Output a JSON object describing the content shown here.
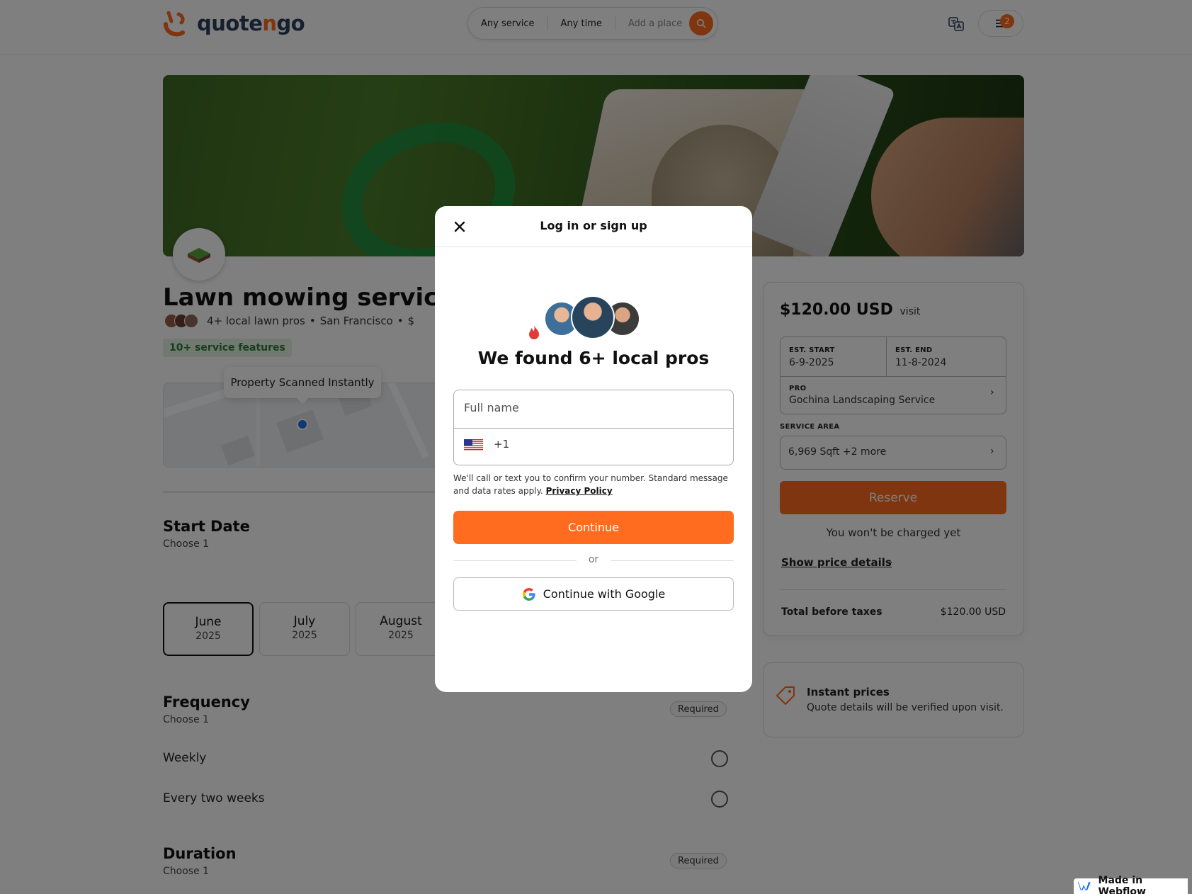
{
  "header": {
    "logo_text_pre": "quote",
    "logo_text_n": "n",
    "logo_text_post": "go",
    "search": {
      "service": "Any service",
      "time": "Any time",
      "place_placeholder": "Add a place"
    },
    "menu_badge": "2"
  },
  "listing": {
    "title": "Lawn mowing service",
    "pros_text": "4+ local lawn pros",
    "location": "San Francisco",
    "price_level": "$",
    "features_chip": "10+ service features",
    "map_tooltip": "Property Scanned Instantly"
  },
  "start_date": {
    "title": "Start Date",
    "sub": "Choose 1",
    "months": [
      {
        "month": "June",
        "year": "2025",
        "selected": true
      },
      {
        "month": "July",
        "year": "2025",
        "selected": false
      },
      {
        "month": "August",
        "year": "2025",
        "selected": false
      }
    ]
  },
  "frequency": {
    "title": "Frequency",
    "sub": "Choose 1",
    "required": "Required",
    "options": [
      "Weekly",
      "Every two weeks"
    ]
  },
  "duration": {
    "title": "Duration",
    "sub": "Choose 1",
    "required": "Required"
  },
  "booking": {
    "price": "$120.00 USD",
    "price_unit": "visit",
    "est_start_label": "EST. START",
    "est_start": "6-9-2025",
    "est_end_label": "EST. END",
    "est_end": "11-8-2024",
    "pro_label": "PRO",
    "pro": "Gochina Landscaping Service",
    "area_label": "SERVICE AREA",
    "area": "6,969 Sqft +2 more",
    "reserve": "Reserve",
    "no_charge": "You won't be charged yet",
    "show_details": "Show price details",
    "total_label": "Total before taxes",
    "total": "$120.00 USD"
  },
  "instant": {
    "title": "Instant prices",
    "sub": "Quote details will be verified upon visit."
  },
  "modal": {
    "title": "Log in or sign up",
    "found": "We found 6+ local pros",
    "fullname_placeholder": "Full name",
    "country_code": "+1",
    "disclaimer": "We'll call or text you to confirm your number. Standard message and data rates apply.",
    "privacy": "Privacy Policy",
    "continue": "Continue",
    "or": "or",
    "google": "Continue with Google"
  },
  "badge": {
    "webflow": "Made in Webflow"
  },
  "colors": {
    "accent": "#ff6b1f",
    "brand_navy": "#2d3e5c",
    "chip_green": "#2e7d32"
  }
}
